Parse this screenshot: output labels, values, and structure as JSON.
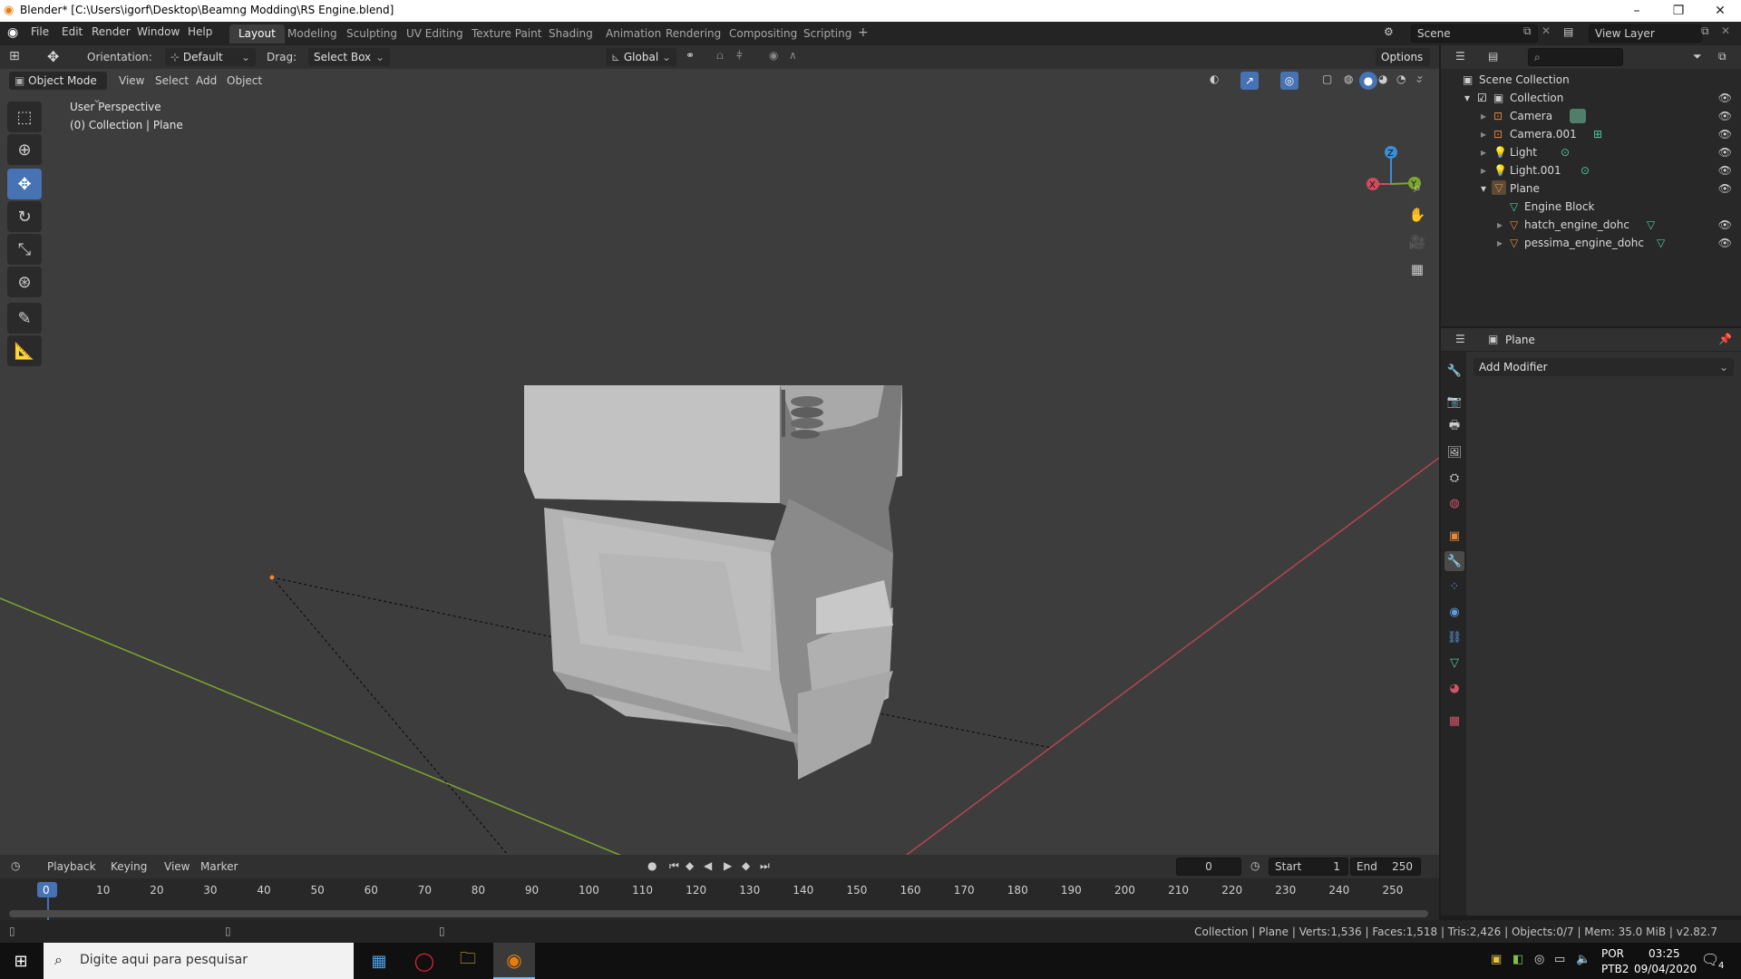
{
  "window": {
    "title": "Blender* [C:\\Users\\igorf\\Desktop\\Beamng Modding\\RS Engine.blend]",
    "controls": [
      "–",
      "❐",
      "✕"
    ]
  },
  "menu": [
    "File",
    "Edit",
    "Render",
    "Window",
    "Help"
  ],
  "workspaces": [
    "Layout",
    "Modeling",
    "Sculpting",
    "UV Editing",
    "Texture Paint",
    "Shading",
    "Animation",
    "Rendering",
    "Compositing",
    "Scripting"
  ],
  "active_workspace": "Layout",
  "scene_field": "Scene",
  "view_layer_field": "View Layer",
  "tool_header": {
    "orientation_label": "Orientation:",
    "orientation_value": "Default",
    "drag_label": "Drag:",
    "drag_value": "Select Box",
    "transform_global": "Global",
    "options": "Options"
  },
  "view_header": {
    "mode": "Object Mode",
    "items": [
      "View",
      "Select",
      "Add",
      "Object"
    ]
  },
  "viewport": {
    "perspective": "User Perspective",
    "collection_info": "(0) Collection | Plane",
    "gizmo": {
      "z": "Z",
      "y": "Y",
      "x": "X"
    }
  },
  "outliner": {
    "scene_collection": "Scene Collection",
    "collection": "Collection",
    "items": [
      {
        "name": "Camera",
        "icon": "camera-icon"
      },
      {
        "name": "Camera.001",
        "icon": "camera-icon"
      },
      {
        "name": "Light",
        "icon": "light-icon"
      },
      {
        "name": "Light.001",
        "icon": "light-icon"
      },
      {
        "name": "Plane",
        "icon": "mesh-object-icon"
      }
    ],
    "children": [
      {
        "name": "Engine Block",
        "icon": "mesh-data-icon"
      },
      {
        "name": "hatch_engine_dohc",
        "icon": "mesh-object-icon"
      },
      {
        "name": "pessima_engine_dohc",
        "icon": "mesh-object-icon"
      }
    ]
  },
  "properties": {
    "object_name": "Plane",
    "add_modifier": "Add Modifier"
  },
  "timeline": {
    "menus": [
      "Playback",
      "Keying",
      "View",
      "Marker"
    ],
    "current_frame": "0",
    "start_label": "Start",
    "start_value": "1",
    "end_label": "End",
    "end_value": "250",
    "ticks": [
      "0",
      "10",
      "20",
      "30",
      "40",
      "50",
      "60",
      "70",
      "80",
      "90",
      "100",
      "110",
      "120",
      "130",
      "140",
      "150",
      "160",
      "170",
      "180",
      "190",
      "200",
      "210",
      "220",
      "230",
      "240",
      "250"
    ]
  },
  "status": {
    "stats": "Collection | Plane | Verts:1,536 | Faces:1,518 | Tris:2,426 | Objects:0/7 | Mem: 35.0 MiB | v2.82.7"
  },
  "taskbar": {
    "search_placeholder": "Digite aqui para pesquisar",
    "lang_1": "POR",
    "lang_2": "PTB2",
    "time": "03:25",
    "date": "09/04/2020",
    "notif_count": "4"
  },
  "colors": {
    "accent": "#4772b3",
    "x_axis": "#d24b5a",
    "y_axis": "#7fa62f",
    "z_axis": "#3b8fd6",
    "object_orange": "#e5883a",
    "mesh_green": "#4ec9a0"
  }
}
